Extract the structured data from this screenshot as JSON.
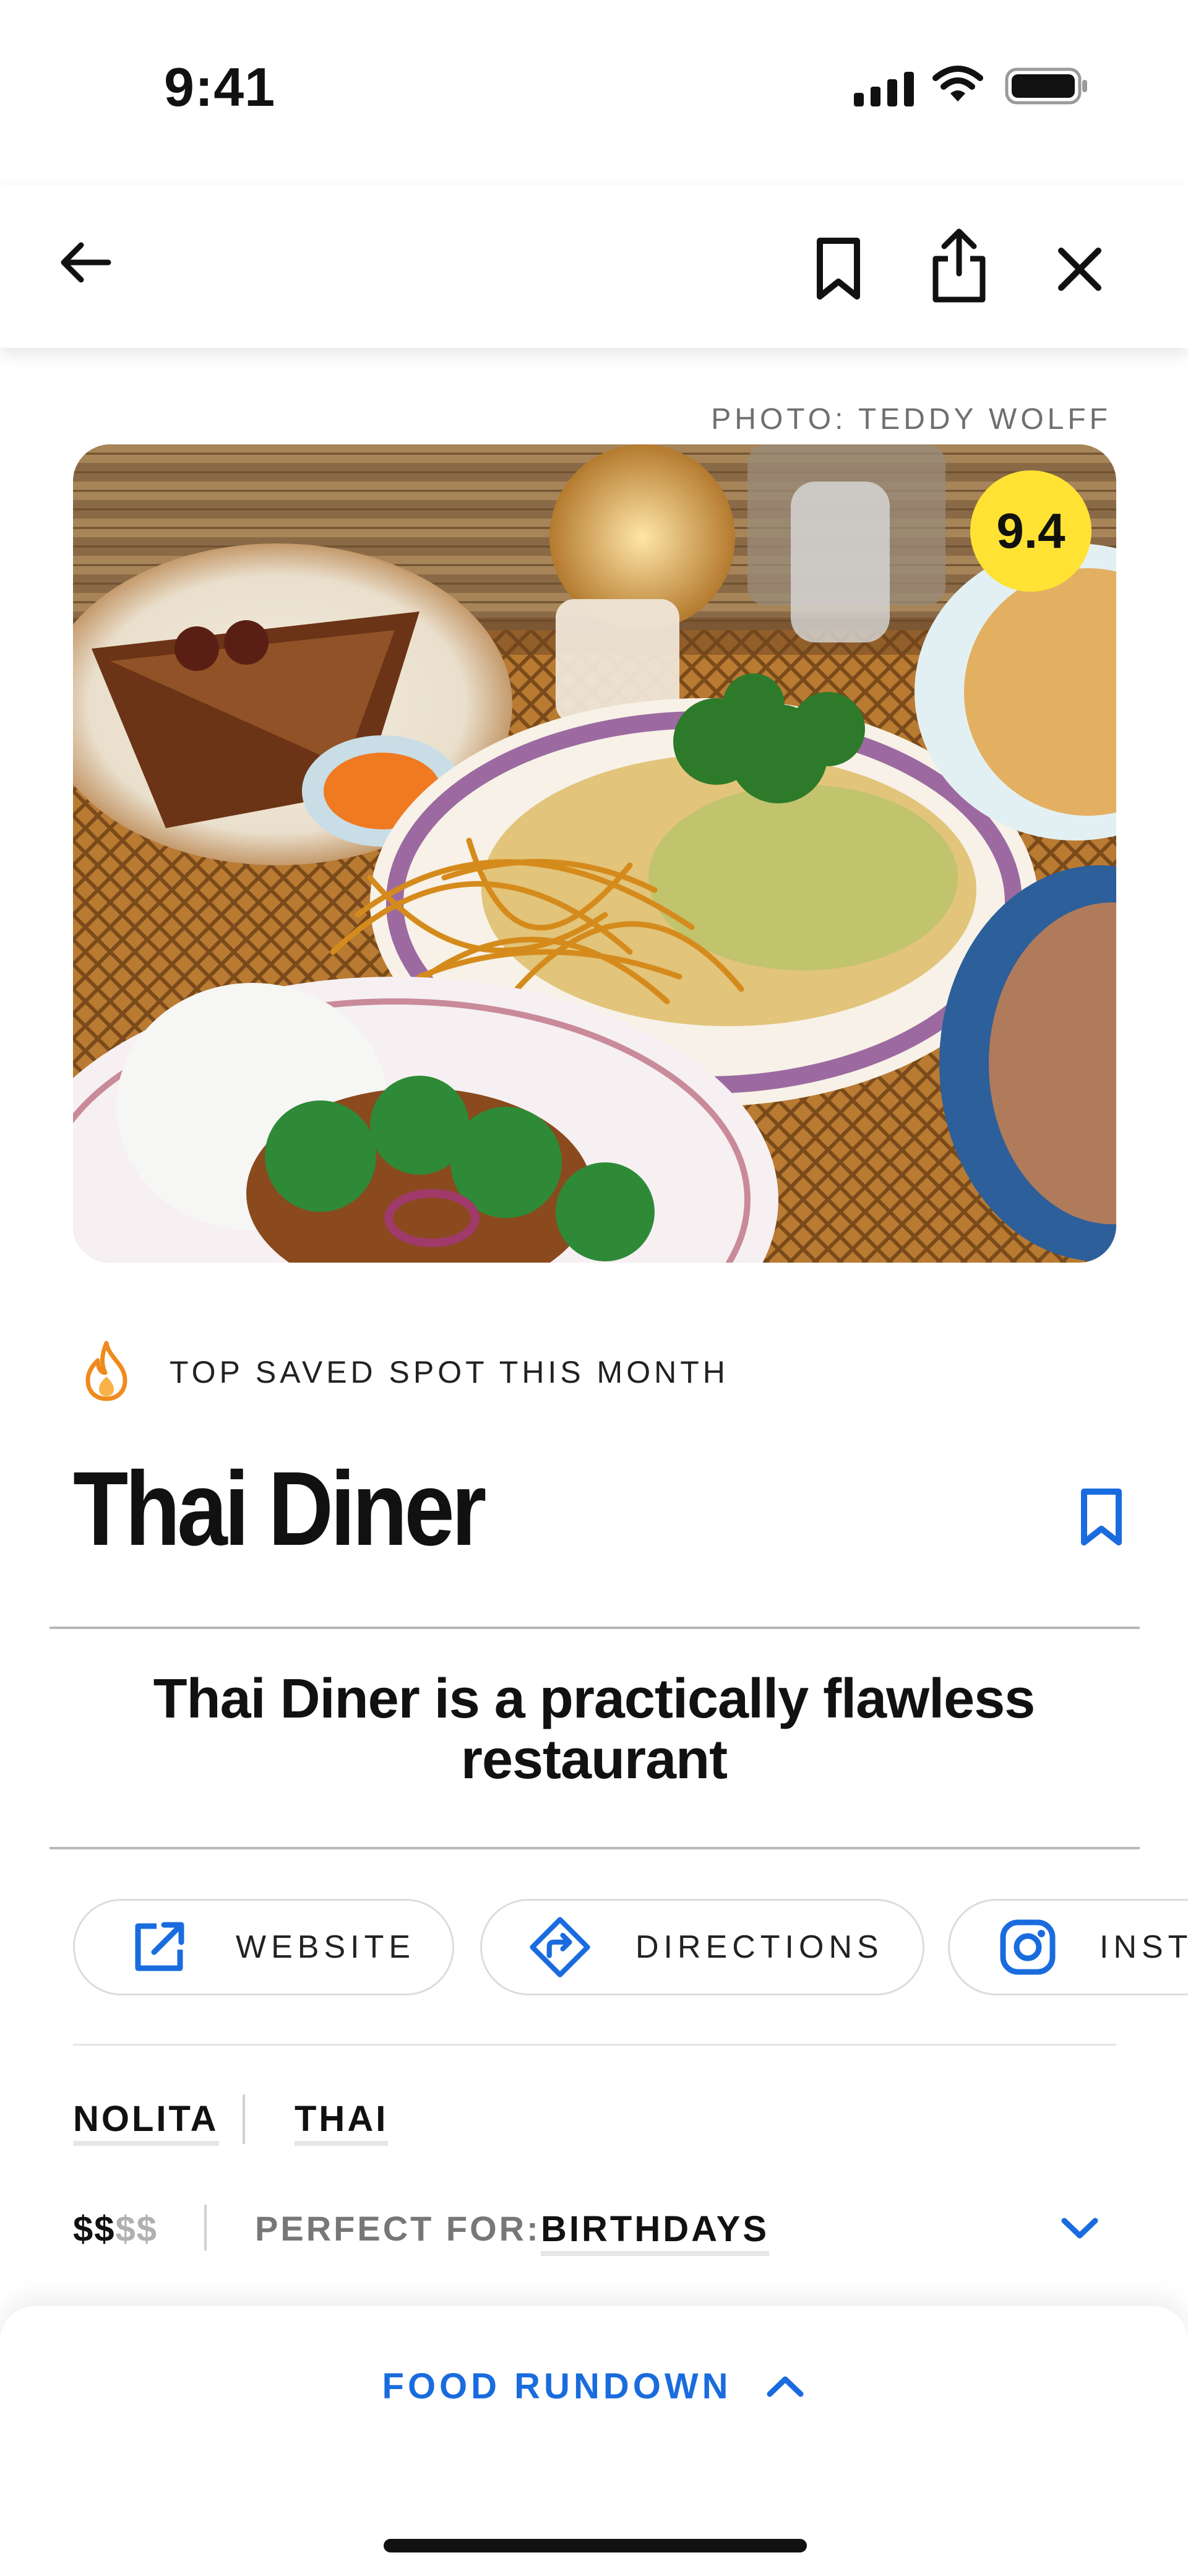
{
  "status_bar": {
    "time": "9:41"
  },
  "header": {
    "back_icon": "arrow-left-icon",
    "bookmark_icon": "bookmark-icon",
    "share_icon": "share-icon",
    "close_icon": "close-icon"
  },
  "hero": {
    "photo_credit": "PHOTO: TEDDY WOLFF",
    "rating": "9.4"
  },
  "highlight": {
    "icon": "flame-icon",
    "text": "TOP SAVED SPOT THIS MONTH"
  },
  "restaurant": {
    "name": "Thai Diner",
    "tagline": "Thai Diner is a practically flawless restaurant"
  },
  "actions": [
    {
      "label": "WEBSITE",
      "icon": "external-link-icon"
    },
    {
      "label": "DIRECTIONS",
      "icon": "directions-icon"
    },
    {
      "label": "INSTA",
      "icon": "instagram-icon"
    }
  ],
  "tags": {
    "neighborhood": "NOLITA",
    "cuisine": "THAI"
  },
  "details": {
    "price_active": "$$",
    "price_inactive": "$$",
    "perfect_for_label": "PERFECT FOR:",
    "perfect_for_value": "BIRTHDAYS"
  },
  "bottom_sheet": {
    "label": "FOOD RUNDOWN"
  },
  "colors": {
    "accent": "#1a6cde",
    "rating_badge": "#ffe234",
    "flame": "#f08a1d",
    "text": "#111111"
  }
}
